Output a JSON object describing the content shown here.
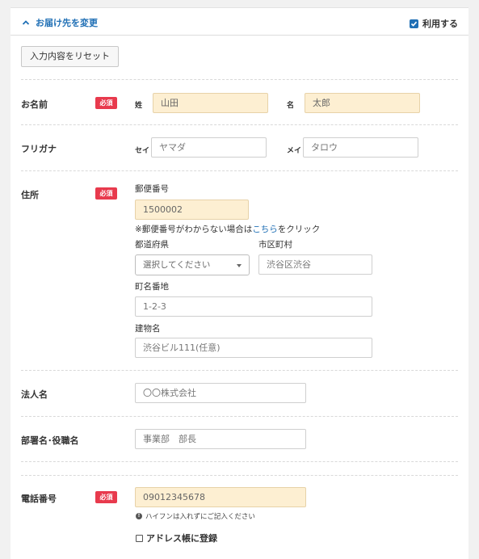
{
  "header": {
    "title": "お届け先を変更",
    "use_label": "利用する",
    "use_checked": true
  },
  "reset_button": "入力内容をリセット",
  "required_badge": "必須",
  "name": {
    "label": "お名前",
    "last_label": "姓",
    "last_value": "山田",
    "first_label": "名",
    "first_value": "太郎"
  },
  "kana": {
    "label": "フリガナ",
    "last_label": "セイ",
    "last_placeholder": "ヤマダ",
    "first_label": "メイ",
    "first_placeholder": "タロウ"
  },
  "address": {
    "label": "住所",
    "zip_label": "郵便番号",
    "zip_value": "1500002",
    "zip_note_prefix": "※郵便番号がわからない場合は",
    "zip_note_link": "こちら",
    "zip_note_suffix": "をクリック",
    "pref_label": "都道府県",
    "pref_placeholder": "選択してください",
    "city_label": "市区町村",
    "city_placeholder": "渋谷区渋谷",
    "town_label": "町名番地",
    "town_placeholder": "1-2-3",
    "building_label": "建物名",
    "building_placeholder": "渋谷ビル111(任意)"
  },
  "company": {
    "label": "法人名",
    "placeholder": "〇〇株式会社"
  },
  "dept": {
    "label": "部署名･役職名",
    "placeholder": "事業部　部長"
  },
  "phone": {
    "label": "電話番号",
    "value": "09012345678",
    "hint": "ハイフンは入れずにご記入ください"
  },
  "address_book": {
    "label": "アドレス帳に登録",
    "checked": false
  },
  "colors": {
    "accent": "#1f6fb5",
    "required": "#e83a4d",
    "filled_input": "#fdefd2"
  }
}
